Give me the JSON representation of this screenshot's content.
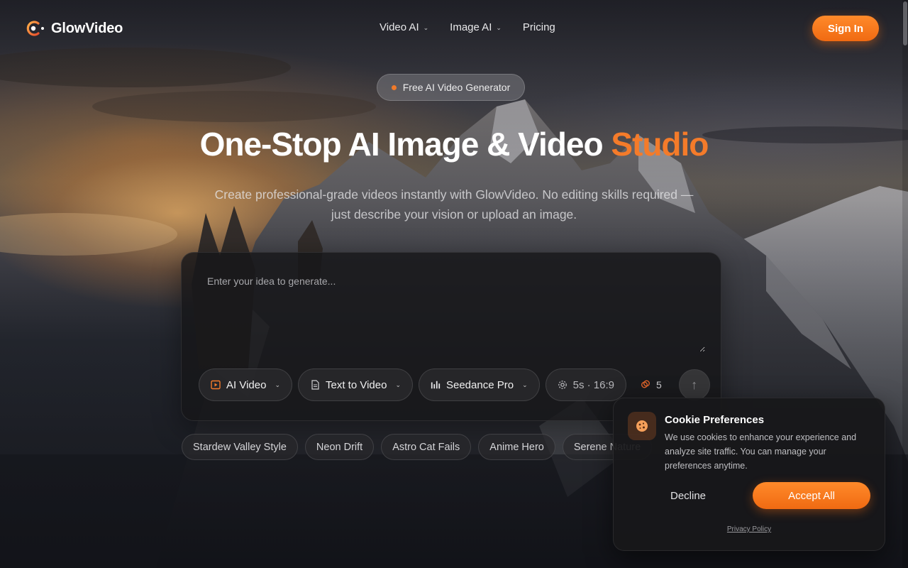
{
  "brand": {
    "name": "GlowVideo",
    "accent": "#f47b2a"
  },
  "nav": {
    "links": [
      {
        "label": "Video AI",
        "dropdown": true
      },
      {
        "label": "Image AI",
        "dropdown": true
      },
      {
        "label": "Pricing",
        "dropdown": false
      }
    ],
    "sign_in": "Sign In"
  },
  "hero": {
    "badge": "Free AI Video Generator",
    "title_main": "One-Stop AI Image & Video ",
    "title_accent": "Studio",
    "subtitle": "Create professional-grade videos instantly with GlowVideo. No editing skills required — just describe your vision or upload an image."
  },
  "prompt": {
    "placeholder": "Enter your idea to generate...",
    "value": "",
    "tools": {
      "mode": {
        "label": "AI Video",
        "icon": "video-frame-icon"
      },
      "type": {
        "label": "Text to Video",
        "icon": "document-icon"
      },
      "model": {
        "label": "Seedance Pro",
        "icon": "bars-icon"
      },
      "settings": {
        "label": "5s · 16:9",
        "icon": "gear-icon"
      }
    },
    "credits": "5",
    "credits_icon": "coins-icon",
    "send_icon": "arrow-up-icon"
  },
  "chips": [
    "Stardew Valley Style",
    "Neon Drift",
    "Astro Cat Fails",
    "Anime Hero",
    "Serene Nature"
  ],
  "cookie": {
    "title": "Cookie Preferences",
    "text": "We use cookies to enhance your experience and analyze site traffic. You can manage your preferences anytime.",
    "decline": "Decline",
    "accept": "Accept All",
    "privacy": "Privacy Policy",
    "icon": "cookie-icon"
  }
}
